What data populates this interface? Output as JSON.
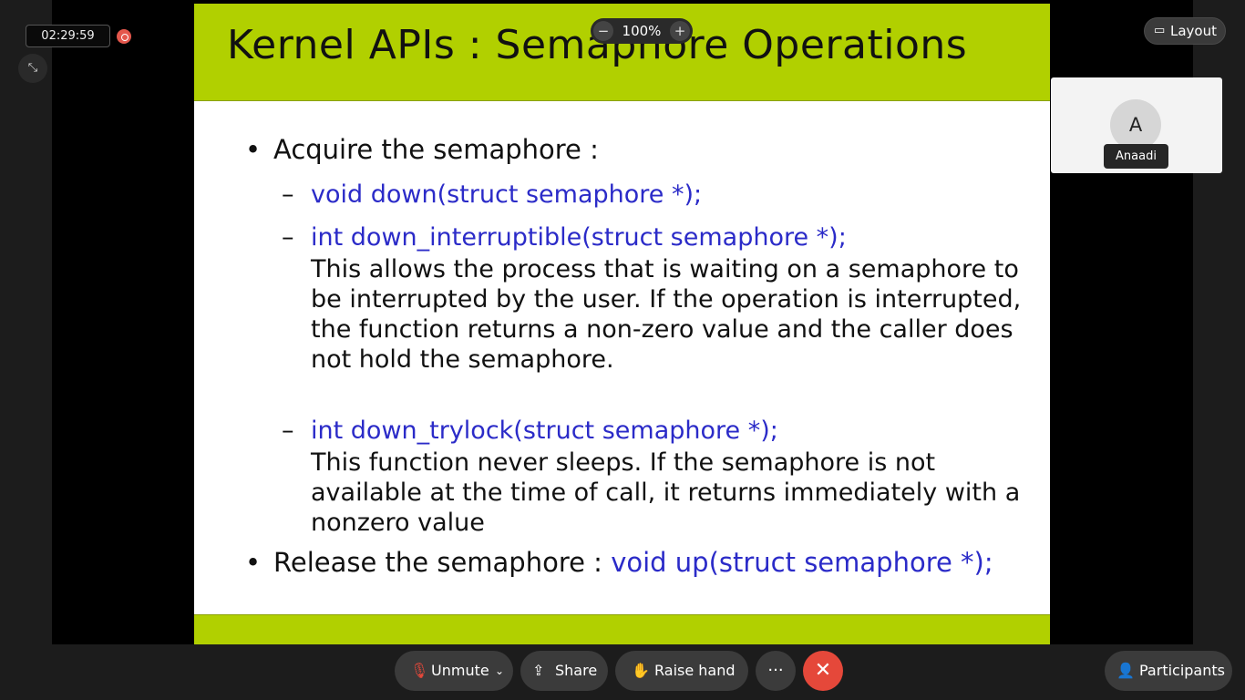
{
  "meeting": {
    "timer": "02:29:59",
    "zoom": {
      "minus": "−",
      "value": "100%",
      "plus": "+"
    },
    "layout_label": "Layout"
  },
  "participant": {
    "initial": "A",
    "name": "Anaadi"
  },
  "slide": {
    "title": "Kernel APIs : Semaphore Operations",
    "bullets": [
      {
        "text": "Acquire the semaphore :"
      },
      {
        "text": "Release the semaphore :",
        "code": "void up(struct semaphore *);"
      }
    ],
    "sub_items": [
      {
        "code": "void down(struct semaphore *);"
      },
      {
        "code": "int down_interruptible(struct semaphore *);",
        "description": "This allows the process that is waiting on a semaphore to be interrupted by the user. If the operation is interrupted, the function returns a non-zero value and the caller does not hold the semaphore."
      },
      {
        "code": "int down_trylock(struct semaphore *);",
        "description": "This function never sleeps. If the semaphore is not available at the time of call, it returns immediately with a nonzero value"
      }
    ],
    "bullet_char": "•",
    "dash_char": "–"
  },
  "controls": {
    "unmute": "Unmute",
    "share": "Share",
    "raise_hand": "Raise hand",
    "more": "···",
    "participants": "Participants"
  },
  "colors": {
    "slide_header": "#b1d000",
    "code_text": "#2b2bc8",
    "leave_button": "#e5483a",
    "recording": "#e4574c"
  }
}
